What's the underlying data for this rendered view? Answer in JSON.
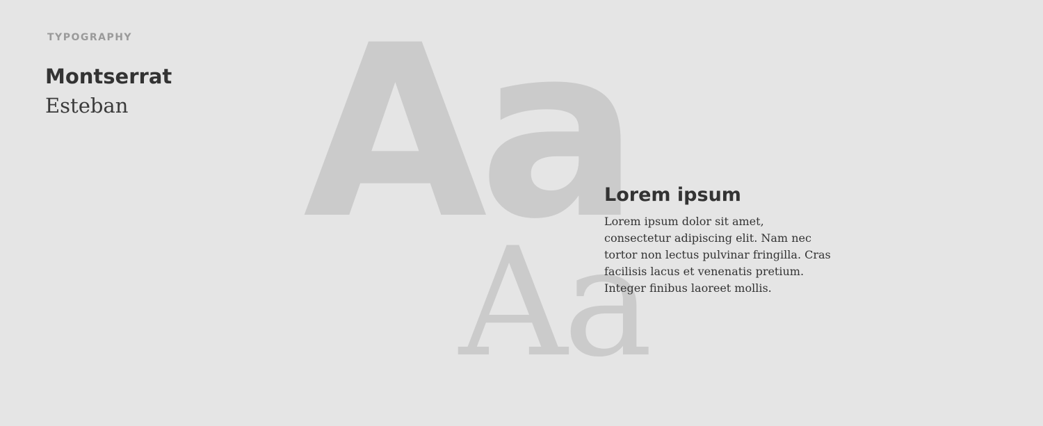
{
  "header": {
    "section_label": "TYPOGRAPHY"
  },
  "fonts": {
    "primary_name": "Montserrat",
    "secondary_name": "Esteban"
  },
  "specimens": {
    "sans_glyphs": "Aa",
    "serif_glyphs": "Aa"
  },
  "sample": {
    "heading": "Lorem ipsum",
    "body": "Lorem ipsum dolor sit amet, consectetur adipiscing elit. Nam nec tortor non lectus pulvinar fringilla. Cras facilisis lacus et venenatis pretium. Integer finibus laoreet mollis."
  },
  "colors": {
    "background": "#e5e5e5",
    "text": "#333333",
    "label": "#9a9a9a",
    "specimen": "#cbcbcb"
  }
}
